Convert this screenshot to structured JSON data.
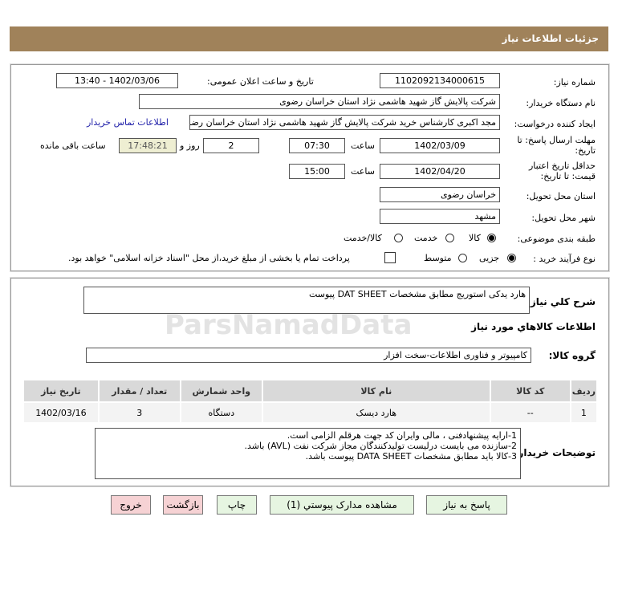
{
  "header": {
    "title": "جزئیات اطلاعات نیاز"
  },
  "form": {
    "need_number_label": "شماره نیاز:",
    "need_number": "1102092134000615",
    "announce_label": "تاریخ و ساعت اعلان عمومی:",
    "announce_value": "1402/03/06 - 13:40",
    "buyer_label": "نام دستگاه خریدار:",
    "buyer_value": "شرکت پالایش گاز شهید هاشمی نژاد   استان خراسان رضوی",
    "creator_label": "ایجاد کننده درخواست:",
    "creator_value": "مجد اکبری کارشناس خرید شرکت پالایش گاز شهید هاشمی نژاد   استان خراسان رضوی",
    "contact_link": "اطلاعات تماس خریدار",
    "deadline_label": "مهلت ارسال پاسخ: تا تاریخ:",
    "deadline_date": "1402/03/09",
    "time_label": "ساعت",
    "deadline_time": "07:30",
    "days": "2",
    "days_label": "روز و",
    "remaining": "17:48:21",
    "remaining_label": "ساعت باقی مانده",
    "validity_label": "حداقل تاریخ اعتبار قیمت: تا تاریخ:",
    "validity_date": "1402/04/20",
    "validity_time": "15:00",
    "province_label": "استان محل تحویل:",
    "province": "خراسان رضوی",
    "city_label": "شهر محل تحویل:",
    "city": "مشهد",
    "category_label": "طبقه بندی موضوعی:",
    "category_options": [
      "کالا",
      "خدمت",
      "کالا/خدمت"
    ],
    "category_selected": "کالا",
    "process_label": "نوع فرآیند خرید :",
    "process_options": [
      "جزیی",
      "متوسط"
    ],
    "process_selected": "جزیی",
    "payment_note": "پرداخت تمام یا بخشی از مبلغ خرید،از محل \"اسناد خزانه اسلامی\" خواهد بود."
  },
  "details": {
    "summary_label": "شرح کلي نياز:",
    "summary": "هارد یدکی استوریج مطابق مشخصات DAT SHEET پیوست",
    "goods_title": "اطلاعات کالاهاي مورد نياز",
    "group_label": "گروه کالا:",
    "group": "کامپیوتر و فناوری اطلاعات-سخت افزار",
    "table": {
      "headers": [
        "ردیف",
        "کد کالا",
        "نام کالا",
        "واحد شمارش",
        "تعداد / مقدار",
        "تاریخ نیاز"
      ],
      "rows": [
        [
          "1",
          "--",
          "هارد دیسک",
          "دستگاه",
          "3",
          "1402/03/16"
        ]
      ]
    },
    "notes_label": "توضیحات خریدار:",
    "notes": [
      "1-ارایه پیشنهادفنی ، مالی وایران کد جهت هرقلم الزامی است.",
      "2-سازنده می بایست درلیست تولیدکنندگان مجاز شرکت نفت (AVL)  باشد.",
      "3-کالا باید مطابق مشخصات DATA SHEET پیوست باشد."
    ]
  },
  "buttons": {
    "reply": "پاسخ به نیاز",
    "attachments": "مشاهده مدارک پیوستي (1)",
    "print": "چاپ",
    "back": "بازگشت",
    "exit": "خروج"
  },
  "watermark": "ParsNamadData"
}
